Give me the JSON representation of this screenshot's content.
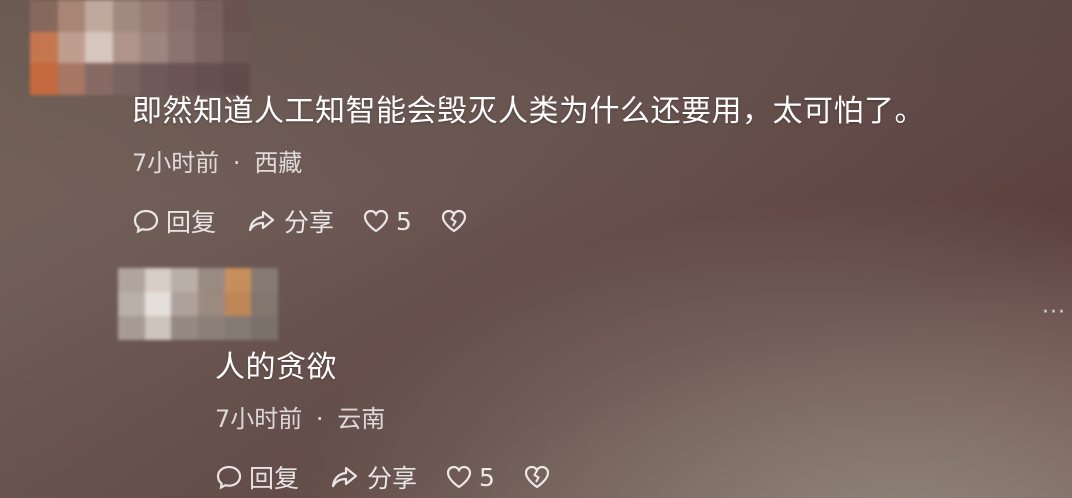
{
  "comments": [
    {
      "text": "即然知道人工知智能会毁灭人类为什么还要用，太可怕了。",
      "time": "7小时前",
      "separator": "·",
      "location": "西藏",
      "reply_label": "回复",
      "share_label": "分享",
      "like_count": "5"
    },
    {
      "text": "人的贪欲",
      "time": "7小时前",
      "separator": "·",
      "location": "云南",
      "reply_label": "回复",
      "share_label": "分享",
      "like_count": "5"
    }
  ],
  "more_label": "···",
  "icons": {
    "reply": "comment-bubble-icon",
    "share": "share-arrow-icon",
    "like": "heart-icon",
    "dislike": "broken-heart-icon"
  }
}
